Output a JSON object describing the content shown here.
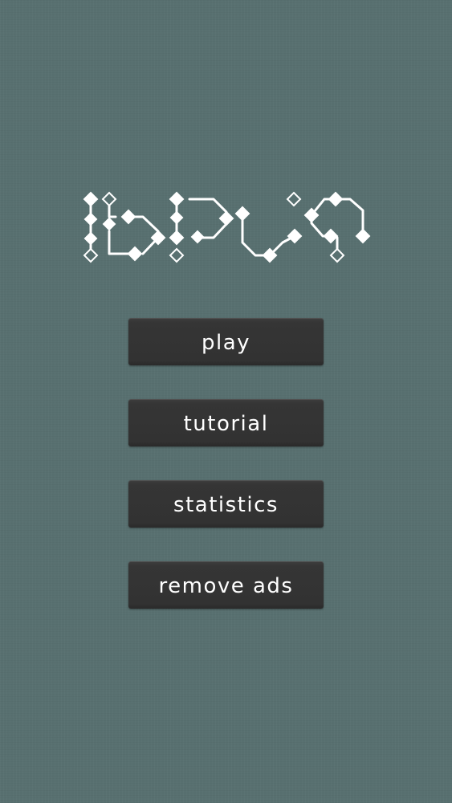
{
  "menu": {
    "play_label": "play",
    "tutorial_label": "tutorial",
    "statistics_label": "statistics",
    "remove_ads_label": "remove ads"
  },
  "colors": {
    "background": "#587070",
    "button": "#333333",
    "button_text": "#ffffff",
    "logo": "#ffffff"
  }
}
